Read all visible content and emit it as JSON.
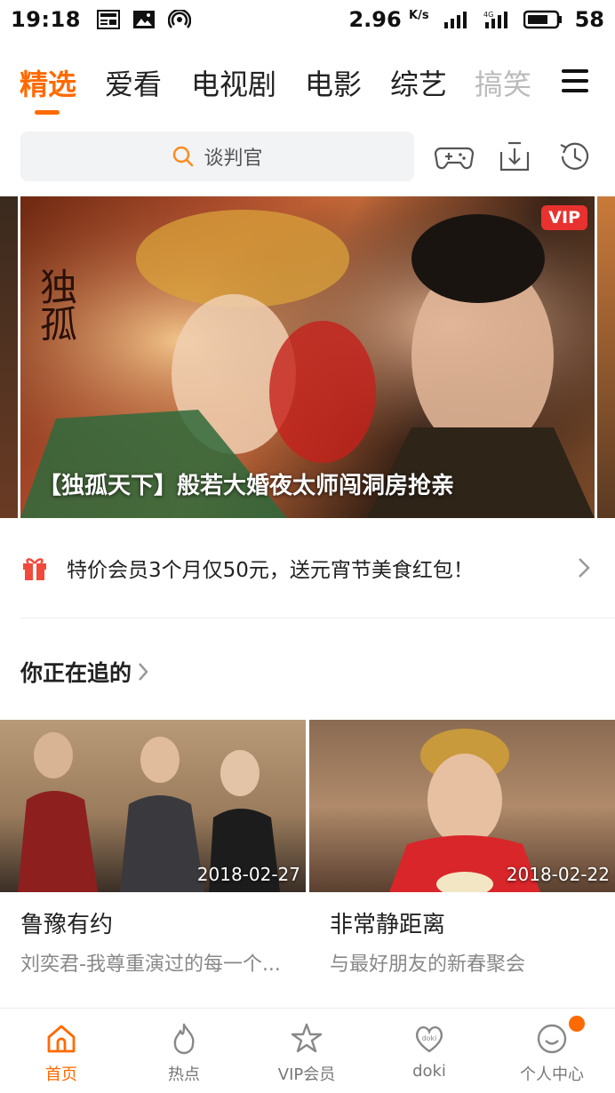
{
  "status_bar": {
    "time": "19:18",
    "speed_value": "2.96",
    "speed_unit": "K/s",
    "battery": "58"
  },
  "nav_tabs": [
    "精选",
    "爱看",
    "电视剧",
    "电影",
    "综艺",
    "搞笑"
  ],
  "active_tab": "精选",
  "search": {
    "placeholder": "谈判官",
    "icons": [
      "game-controller-icon",
      "download-icon",
      "history-icon"
    ]
  },
  "banner": {
    "caption": "【独孤天下】般若大婚夜太师闯洞房抢亲",
    "badge": "VIP"
  },
  "promo": {
    "text": "特价会员3个月仅50元，送元宵节美食红包！"
  },
  "section": {
    "title": "你正在追的"
  },
  "videos": [
    {
      "title": "鲁豫有约",
      "subtitle": "刘奕君-我尊重演过的每一个...",
      "date": "2018-02-27"
    },
    {
      "title": "非常静距离",
      "subtitle": "与最好朋友的新春聚会",
      "date": "2018-02-22"
    }
  ],
  "bottom_nav": [
    {
      "label": "首页",
      "icon": "home-icon",
      "active": true
    },
    {
      "label": "热点",
      "icon": "flame-icon",
      "active": false
    },
    {
      "label": "VIP会员",
      "icon": "vip-star-icon",
      "active": false
    },
    {
      "label": "doki",
      "icon": "doki-heart-icon",
      "active": false
    },
    {
      "label": "个人中心",
      "icon": "profile-icon",
      "active": false
    }
  ],
  "colors": {
    "accent": "#ff6a00",
    "vip_badge": "#e8322f",
    "promo_gift": "#f04a3c"
  }
}
